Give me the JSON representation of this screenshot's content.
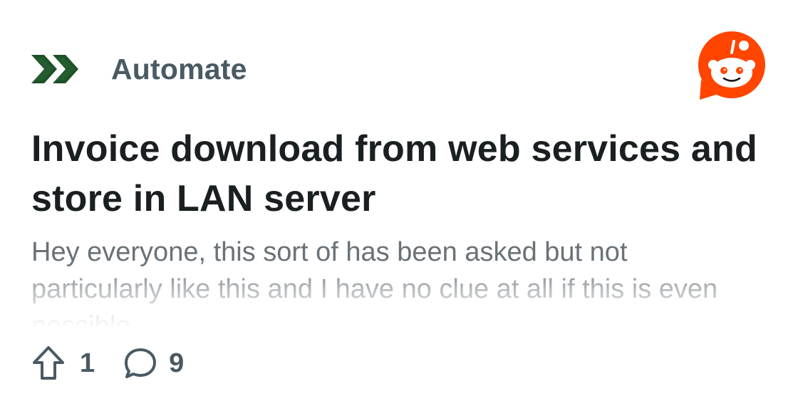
{
  "community": {
    "icon": "double-chevron-right-icon",
    "name": "Automate",
    "icon_color": "#1e5128"
  },
  "brand": {
    "icon": "reddit-logo-icon",
    "color": "#ff4500"
  },
  "post": {
    "title": "Invoice download from web services and store in LAN server",
    "excerpt": "Hey everyone, this sort of has been asked but not particularly like this and I have no clue at all if this is even possible"
  },
  "stats": {
    "upvote_icon": "upvote-arrow-icon",
    "upvotes": "1",
    "comment_icon": "comment-bubble-icon",
    "comments": "9"
  },
  "colors": {
    "title": "#1a1f22",
    "muted": "#4a5a63",
    "excerpt": "#6a7278"
  }
}
